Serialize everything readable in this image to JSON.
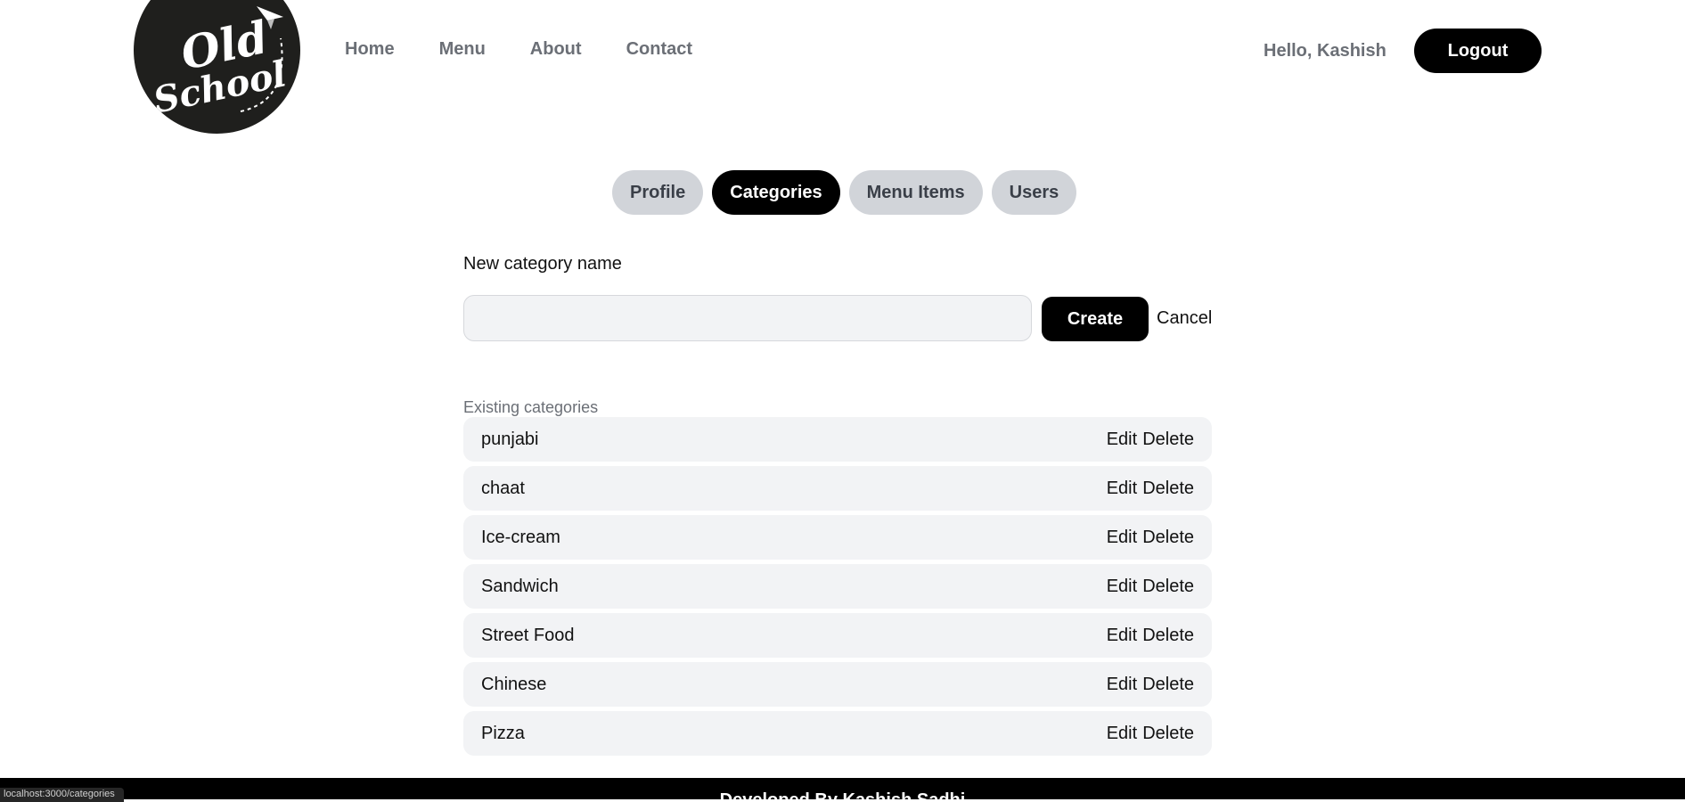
{
  "brand": {
    "logo_text_1": "Old",
    "logo_text_2": "School"
  },
  "nav": {
    "items": [
      {
        "label": "Home"
      },
      {
        "label": "Menu"
      },
      {
        "label": "About"
      },
      {
        "label": "Contact"
      }
    ]
  },
  "user": {
    "greeting": "Hello, Kashish",
    "logout_label": "Logout"
  },
  "tabs": [
    {
      "label": "Profile",
      "active": false
    },
    {
      "label": "Categories",
      "active": true
    },
    {
      "label": "Menu Items",
      "active": false
    },
    {
      "label": "Users",
      "active": false
    }
  ],
  "form": {
    "label": "New category name",
    "value": "",
    "placeholder": "",
    "create_label": "Create",
    "cancel_label": "Cancel"
  },
  "categories": {
    "heading": "Existing categories",
    "edit_label": "Edit",
    "delete_label": "Delete",
    "items": [
      {
        "name": "punjabi"
      },
      {
        "name": "chaat"
      },
      {
        "name": "Ice-cream"
      },
      {
        "name": "Sandwich"
      },
      {
        "name": "Street Food"
      },
      {
        "name": "Chinese"
      },
      {
        "name": "Pizza"
      }
    ]
  },
  "footer": {
    "text": "Developed By Kashish Sadhi"
  },
  "status_bar": {
    "url": "localhost:3000/categories"
  },
  "colors": {
    "primary": "#000000",
    "tab_inactive": "#d1d4d9",
    "row_bg": "#f2f3f5",
    "muted_text": "#6b6f76",
    "logo_bg": "#1f1f1d"
  }
}
